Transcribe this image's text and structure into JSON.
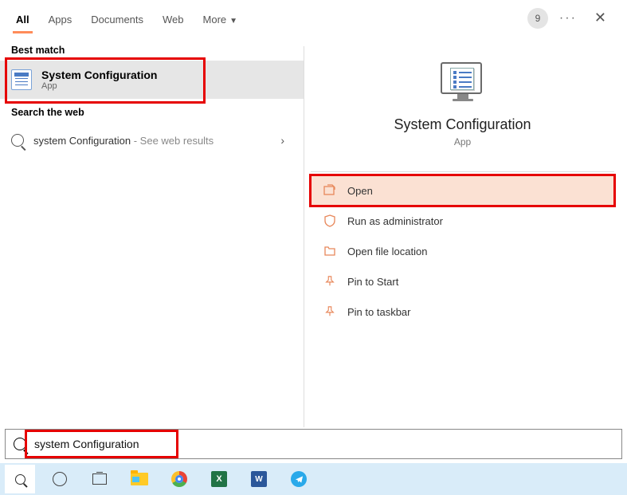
{
  "topbar": {
    "tabs": [
      "All",
      "Apps",
      "Documents",
      "Web",
      "More"
    ],
    "badge": "9"
  },
  "left": {
    "best_match_label": "Best match",
    "best_match": {
      "title": "System Configuration",
      "subtitle": "App"
    },
    "web_label": "Search the web",
    "web_result": {
      "query": "system Configuration",
      "suffix": " - See web results"
    }
  },
  "detail": {
    "title": "System Configuration",
    "subtitle": "App",
    "actions": {
      "open": "Open",
      "run_admin": "Run as administrator",
      "open_loc": "Open file location",
      "pin_start": "Pin to Start",
      "pin_taskbar": "Pin to taskbar"
    }
  },
  "searchbar": {
    "value": "system Configuration"
  },
  "taskbar": {
    "excel": "X",
    "word": "W"
  }
}
